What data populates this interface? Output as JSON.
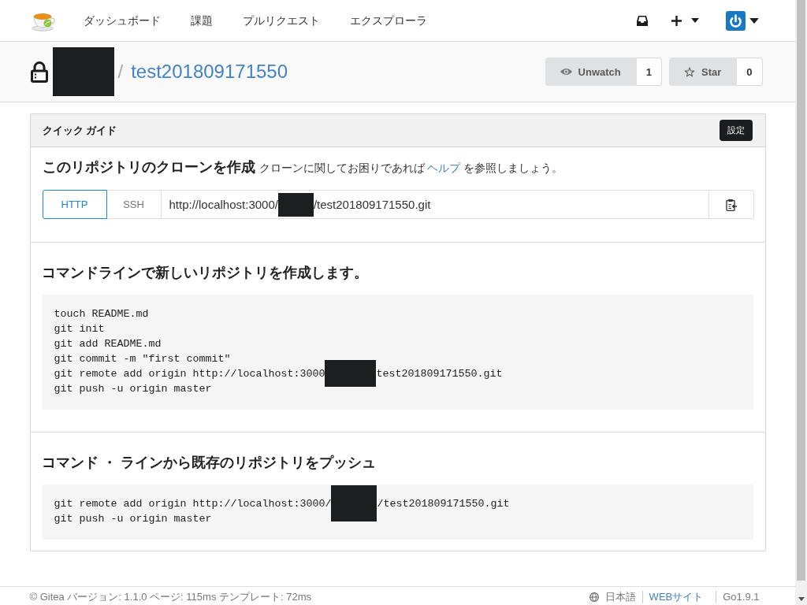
{
  "navbar": {
    "items": [
      "ダッシュボード",
      "課題",
      "プルリクエスト",
      "エクスプローラ"
    ]
  },
  "repo_header": {
    "separator": "/",
    "name": "test201809171550",
    "actions": [
      {
        "kind": "watch",
        "label": "Unwatch",
        "count": "1"
      },
      {
        "kind": "star",
        "label": "Star",
        "count": "0"
      }
    ]
  },
  "quick_guide": {
    "title": "クイック ガイド",
    "settings_button": "設定",
    "clone": {
      "title": "このリポジトリのクローンを作成",
      "help": {
        "before": "クローンに関してお困りであれば ",
        "link": "ヘルプ",
        "after": " を参照しましょう。"
      },
      "protocols": [
        {
          "label": "HTTP",
          "selected": true
        },
        {
          "label": "SSH",
          "selected": false
        }
      ],
      "url": [
        {
          "kind": "text",
          "text": "http://localhost:3000/"
        },
        {
          "kind": "redacted"
        },
        {
          "kind": "text",
          "text": "/test201809171550.git"
        }
      ]
    },
    "sections": [
      {
        "title": "コマンドラインで新しいリポジトリを作成します。",
        "code": [
          [
            {
              "kind": "text",
              "text": "touch README.md"
            }
          ],
          [
            {
              "kind": "text",
              "text": "git init"
            }
          ],
          [
            {
              "kind": "text",
              "text": "git add README.md"
            }
          ],
          [
            {
              "kind": "text",
              "text": "git commit -m \"first commit\""
            }
          ],
          [
            {
              "kind": "text",
              "text": "git remote add origin http://localhost:3000"
            },
            {
              "kind": "redacted"
            },
            {
              "kind": "text",
              "text": "test201809171550.git"
            }
          ],
          [
            {
              "kind": "text",
              "text": "git push -u origin master"
            }
          ]
        ]
      },
      {
        "title": "コマンド ・ ラインから既存のリポジトリをプッシュ",
        "code": [
          [
            {
              "kind": "text",
              "text": "git remote add origin http://localhost:3000/"
            },
            {
              "kind": "redacted"
            },
            {
              "kind": "text",
              "text": "/test201809171550.git"
            }
          ],
          [
            {
              "kind": "text",
              "text": "git push -u origin master"
            }
          ]
        ]
      }
    ]
  },
  "footer": {
    "info": "© Gitea バージョン: 1.1.0 ページ: 115ms テンプレート: 72ms",
    "language": "日本語",
    "links": [
      {
        "kind": "link",
        "text": "WEBサイト"
      },
      {
        "kind": "text",
        "text": "Go1.9.1"
      }
    ]
  }
}
